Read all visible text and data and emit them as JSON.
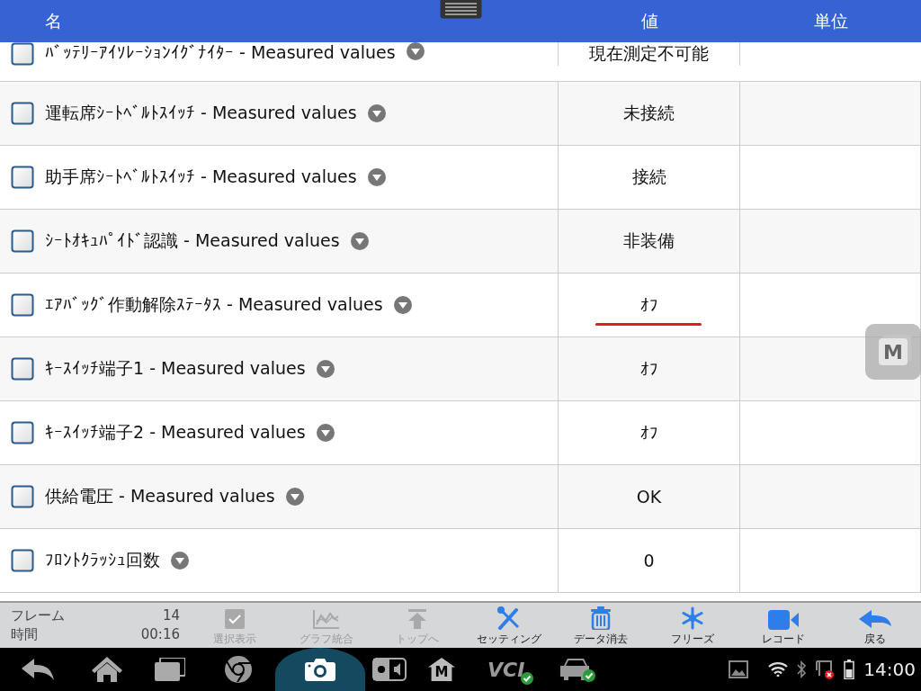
{
  "header": {
    "columns": [
      "名",
      "値",
      "単位"
    ]
  },
  "rows": [
    {
      "name": "ﾊﾞｯﾃﾘｰｱｲｿﾚｰｼｮﾝｲｸﾞﾅｲﾀｰ - Measured values",
      "value": "現在測定不可能",
      "checked": false,
      "underlined": false
    },
    {
      "name": "運転席ｼｰﾄﾍﾞﾙﾄｽｲｯﾁ - Measured values",
      "value": "未接続",
      "checked": false,
      "underlined": false
    },
    {
      "name": "助手席ｼｰﾄﾍﾞﾙﾄｽｲｯﾁ - Measured values",
      "value": "接続",
      "checked": false,
      "underlined": false
    },
    {
      "name": "ｼｰﾄｵｷｭﾊﾟｲﾄﾞ認識 - Measured values",
      "value": "非装備",
      "checked": false,
      "underlined": false
    },
    {
      "name": "ｴｱﾊﾞｯｸﾞ作動解除ｽﾃｰﾀｽ - Measured values",
      "value": "ｵﾌ",
      "checked": false,
      "underlined": true
    },
    {
      "name": "ｷｰｽｲｯﾁ端子1 - Measured values",
      "value": "ｵﾌ",
      "checked": false,
      "underlined": false
    },
    {
      "name": "ｷｰｽｲｯﾁ端子2 - Measured values",
      "value": "ｵﾌ",
      "checked": false,
      "underlined": false
    },
    {
      "name": "供給電圧 - Measured values",
      "value": "OK",
      "checked": false,
      "underlined": false
    },
    {
      "name": "ﾌﾛﾝﾄｸﾗｯｼｭ回数",
      "value": "0",
      "checked": false,
      "underlined": false
    }
  ],
  "floating_button": {
    "label": "M"
  },
  "toolbar": {
    "frame_label": "フレーム",
    "frame_count": "14",
    "time_label": "時間",
    "time_value": "00:16",
    "buttons": [
      {
        "kind": "check",
        "label": "選択表示",
        "disabled": true
      },
      {
        "kind": "graph",
        "label": "グラフ統合",
        "disabled": true
      },
      {
        "kind": "top",
        "label": "トップへ",
        "disabled": true
      },
      {
        "kind": "tools",
        "label": "セッティング",
        "disabled": false
      },
      {
        "kind": "trash",
        "label": "データ消去",
        "disabled": false
      },
      {
        "kind": "snow",
        "label": "フリーズ",
        "disabled": false
      },
      {
        "kind": "video",
        "label": "レコード",
        "disabled": false
      },
      {
        "kind": "back",
        "label": "戻る",
        "disabled": false
      }
    ]
  },
  "nav_bar": {
    "home_badge": "M",
    "vci_label": "VCI",
    "time": "14:00"
  }
}
